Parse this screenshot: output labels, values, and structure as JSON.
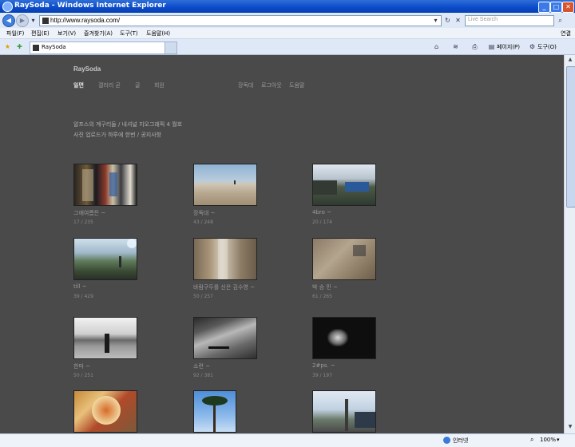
{
  "window": {
    "title": "RaySoda - Windows Internet Explorer",
    "url": "http://www.raysoda.com/",
    "search_placeholder": "Live Search"
  },
  "menu": [
    "파일(F)",
    "편집(E)",
    "보기(V)",
    "즐겨찾기(A)",
    "도구(T)",
    "도움말(H)"
  ],
  "menu_right": "연결",
  "tab": {
    "title": "RaySoda"
  },
  "toolbar": {
    "page": "페이지(P)",
    "tools": "도구(O)"
  },
  "site": {
    "brand": "RaySoda",
    "nav_left": [
      {
        "label": "일면",
        "active": true
      },
      {
        "label": "갤러리 곧",
        "active": false
      },
      {
        "label": "글",
        "active": false
      },
      {
        "label": "회원",
        "active": false
      }
    ],
    "nav_right": [
      "장독대",
      "로그아웃",
      "도움말"
    ],
    "notices": [
      "알프스의 계구리들 / 내셔널 지오그래픽 4 월호",
      "사진 업로드가 하루에 한번 / 공지사항"
    ]
  },
  "gallery": [
    {
      "caption": "그애여름든 ~",
      "count": "17 / 235",
      "scene": "market"
    },
    {
      "caption": "장독대 ~",
      "count": "43 / 248",
      "scene": "desert"
    },
    {
      "caption": "4bro ~",
      "count": "20 / 174",
      "scene": "village"
    },
    {
      "caption": "till ~",
      "count": "39 / 429",
      "scene": "field"
    },
    {
      "caption": "바람구두를 신은 김수영 ~",
      "count": "50 / 257",
      "scene": "alley"
    },
    {
      "caption": "박 승 민 ~",
      "count": "61 / 265",
      "scene": "ground"
    },
    {
      "caption": "한마 ~",
      "count": "50 / 251",
      "scene": "beach"
    },
    {
      "caption": "소련 ~",
      "count": "92 / 381",
      "scene": "dunes"
    },
    {
      "caption": "2#ps. ~",
      "count": "39 / 197",
      "scene": "flowers"
    },
    {
      "caption": "",
      "count": "",
      "scene": "food"
    },
    {
      "caption": "",
      "count": "",
      "scene": "palm"
    },
    {
      "caption": "",
      "count": "",
      "scene": "road"
    }
  ],
  "status": {
    "zone": "인터넷",
    "zoom": "100%"
  },
  "colors": {
    "page_bg": "#4a4a4a",
    "titlebar": "#0a4ac9",
    "link_gray": "#9a9a9a"
  }
}
